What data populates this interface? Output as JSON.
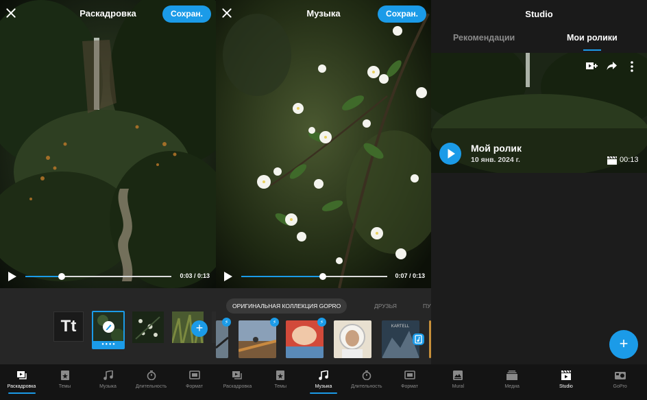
{
  "storyboard": {
    "title": "Раскадровка",
    "save": "Сохран.",
    "time": "0:03 / 0:13",
    "progress": 0.25,
    "title_tile": "Tt",
    "selected_dots": "● ● ● ●"
  },
  "music": {
    "title": "Музыка",
    "save": "Сохран.",
    "time": "0:07 / 0:13",
    "progress": 0.56,
    "chip_active": "ОРИГИНАЛЬНАЯ КОЛЛЕКЦИЯ GOPRO",
    "chip_friends": "ДРУЗЬЯ",
    "chip_partial": "ПУ",
    "card_text": "KARTELL"
  },
  "studio": {
    "title": "Studio",
    "tabs": [
      "Рекомендации",
      "Мои ролики"
    ],
    "video_title": "Мой ролик",
    "video_date": "10 янв. 2024 г.",
    "duration": "00:13",
    "fab": "+"
  },
  "editor_nav": [
    "Раскадровка",
    "Темы",
    "Музыка",
    "Длительность",
    "Формат"
  ],
  "app_nav": [
    "Mural",
    "Медиа",
    "Studio",
    "GoPro"
  ],
  "colors": {
    "accent": "#1b9be8"
  }
}
